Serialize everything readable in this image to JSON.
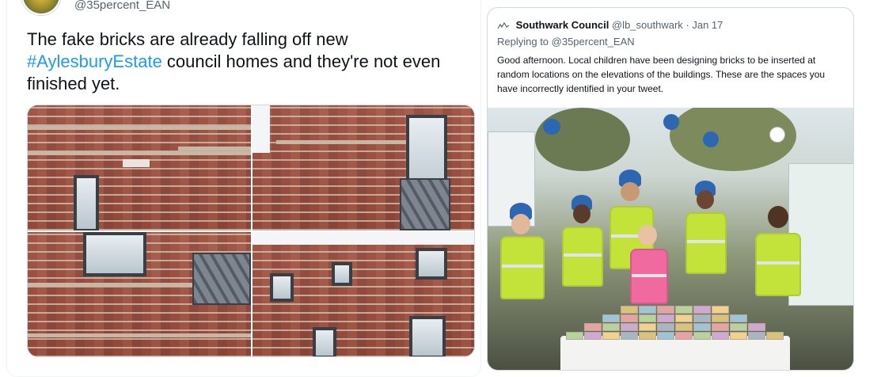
{
  "tweet": {
    "handle": "@35percent_EAN",
    "text_before": "The fake bricks are already falling off new ",
    "hashtag": "#AylesburyEstate",
    "text_after": " council homes and they're not even finished yet."
  },
  "quoted_tweet": {
    "name": "Southwark Council",
    "handle": "@lb_southwark",
    "date": "· Jan 17",
    "replying_to": "Replying to @35percent_EAN",
    "body": "Good afternoon. Local children have been designing bricks to be inserted at random locations on the elevations of the buildings. These are the spaces you have incorrectly identified in your tweet."
  },
  "colors": {
    "link": "#1d9bf0",
    "secondary_text": "#536471",
    "border": "#cfd9de"
  }
}
